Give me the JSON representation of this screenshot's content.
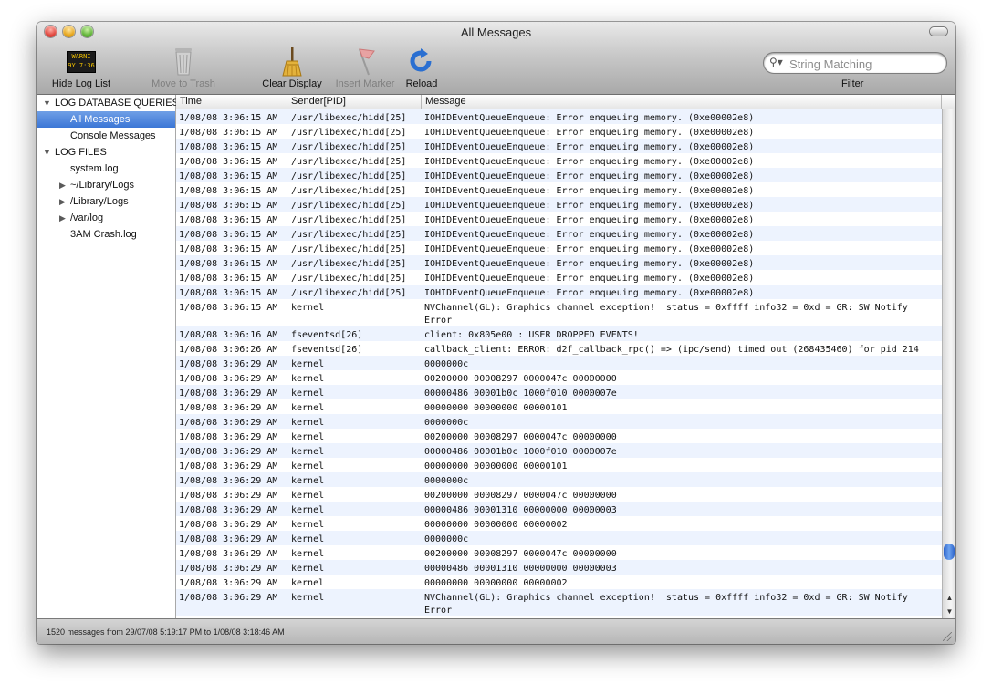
{
  "window": {
    "title": "All Messages"
  },
  "toolbar": {
    "hide_log_list": "Hide Log List",
    "move_to_trash": "Move to Trash",
    "clear_display": "Clear Display",
    "insert_marker": "Insert Marker",
    "reload": "Reload",
    "warning_icon_text": "WARNI\n9Y 7:36",
    "search_placeholder": "String Matching",
    "filter_label": "Filter"
  },
  "sidebar": {
    "sections": [
      {
        "label": "LOG DATABASE QUERIES",
        "items": [
          "All Messages",
          "Console Messages"
        ]
      },
      {
        "label": "LOG FILES",
        "items": [
          "system.log",
          "~/Library/Logs",
          "/Library/Logs",
          "/var/log",
          "3AM Crash.log"
        ]
      }
    ],
    "selected": "All Messages"
  },
  "table": {
    "columns": [
      "Time",
      "Sender[PID]",
      "Message"
    ],
    "rows": [
      [
        "1/08/08 3:06:15 AM",
        "/usr/libexec/hidd[25]",
        "IOHIDEventQueueEnqueue: Error enqueuing memory. (0xe00002e8)"
      ],
      [
        "1/08/08 3:06:15 AM",
        "/usr/libexec/hidd[25]",
        "IOHIDEventQueueEnqueue: Error enqueuing memory. (0xe00002e8)"
      ],
      [
        "1/08/08 3:06:15 AM",
        "/usr/libexec/hidd[25]",
        "IOHIDEventQueueEnqueue: Error enqueuing memory. (0xe00002e8)"
      ],
      [
        "1/08/08 3:06:15 AM",
        "/usr/libexec/hidd[25]",
        "IOHIDEventQueueEnqueue: Error enqueuing memory. (0xe00002e8)"
      ],
      [
        "1/08/08 3:06:15 AM",
        "/usr/libexec/hidd[25]",
        "IOHIDEventQueueEnqueue: Error enqueuing memory. (0xe00002e8)"
      ],
      [
        "1/08/08 3:06:15 AM",
        "/usr/libexec/hidd[25]",
        "IOHIDEventQueueEnqueue: Error enqueuing memory. (0xe00002e8)"
      ],
      [
        "1/08/08 3:06:15 AM",
        "/usr/libexec/hidd[25]",
        "IOHIDEventQueueEnqueue: Error enqueuing memory. (0xe00002e8)"
      ],
      [
        "1/08/08 3:06:15 AM",
        "/usr/libexec/hidd[25]",
        "IOHIDEventQueueEnqueue: Error enqueuing memory. (0xe00002e8)"
      ],
      [
        "1/08/08 3:06:15 AM",
        "/usr/libexec/hidd[25]",
        "IOHIDEventQueueEnqueue: Error enqueuing memory. (0xe00002e8)"
      ],
      [
        "1/08/08 3:06:15 AM",
        "/usr/libexec/hidd[25]",
        "IOHIDEventQueueEnqueue: Error enqueuing memory. (0xe00002e8)"
      ],
      [
        "1/08/08 3:06:15 AM",
        "/usr/libexec/hidd[25]",
        "IOHIDEventQueueEnqueue: Error enqueuing memory. (0xe00002e8)"
      ],
      [
        "1/08/08 3:06:15 AM",
        "/usr/libexec/hidd[25]",
        "IOHIDEventQueueEnqueue: Error enqueuing memory. (0xe00002e8)"
      ],
      [
        "1/08/08 3:06:15 AM",
        "/usr/libexec/hidd[25]",
        "IOHIDEventQueueEnqueue: Error enqueuing memory. (0xe00002e8)"
      ],
      [
        "1/08/08 3:06:15 AM",
        "kernel",
        "NVChannel(GL): Graphics channel exception!  status = 0xffff info32 = 0xd = GR: SW Notify Error"
      ],
      [
        "1/08/08 3:06:16 AM",
        "fseventsd[26]",
        "client: 0x805e00 : USER DROPPED EVENTS!"
      ],
      [
        "1/08/08 3:06:26 AM",
        "fseventsd[26]",
        "callback_client: ERROR: d2f_callback_rpc() => (ipc/send) timed out (268435460) for pid 214"
      ],
      [
        "1/08/08 3:06:29 AM",
        "kernel",
        "0000000c"
      ],
      [
        "1/08/08 3:06:29 AM",
        "kernel",
        "00200000 00008297 0000047c 00000000"
      ],
      [
        "1/08/08 3:06:29 AM",
        "kernel",
        "00000486 00001b0c 1000f010 0000007e"
      ],
      [
        "1/08/08 3:06:29 AM",
        "kernel",
        "00000000 00000000 00000101"
      ],
      [
        "1/08/08 3:06:29 AM",
        "kernel",
        "0000000c"
      ],
      [
        "1/08/08 3:06:29 AM",
        "kernel",
        "00200000 00008297 0000047c 00000000"
      ],
      [
        "1/08/08 3:06:29 AM",
        "kernel",
        "00000486 00001b0c 1000f010 0000007e"
      ],
      [
        "1/08/08 3:06:29 AM",
        "kernel",
        "00000000 00000000 00000101"
      ],
      [
        "1/08/08 3:06:29 AM",
        "kernel",
        "0000000c"
      ],
      [
        "1/08/08 3:06:29 AM",
        "kernel",
        "00200000 00008297 0000047c 00000000"
      ],
      [
        "1/08/08 3:06:29 AM",
        "kernel",
        "00000486 00001310 00000000 00000003"
      ],
      [
        "1/08/08 3:06:29 AM",
        "kernel",
        "00000000 00000000 00000002"
      ],
      [
        "1/08/08 3:06:29 AM",
        "kernel",
        "0000000c"
      ],
      [
        "1/08/08 3:06:29 AM",
        "kernel",
        "00200000 00008297 0000047c 00000000"
      ],
      [
        "1/08/08 3:06:29 AM",
        "kernel",
        "00000486 00001310 00000000 00000003"
      ],
      [
        "1/08/08 3:06:29 AM",
        "kernel",
        "00000000 00000000 00000002"
      ],
      [
        "1/08/08 3:06:29 AM",
        "kernel",
        "NVChannel(GL): Graphics channel exception!  status = 0xffff info32 = 0xd = GR: SW Notify Error"
      ]
    ]
  },
  "status": {
    "text": "1520 messages from 29/07/08 5:19:17 PM to 1/08/08 3:18:46 AM"
  },
  "colors": {
    "selection": "#3b76d6",
    "alt_row": "#edf3fe"
  },
  "icons": [
    "warning-log-icon",
    "trash-icon",
    "broom-icon",
    "marker-flag-icon",
    "reload-icon",
    "search-icon"
  ]
}
